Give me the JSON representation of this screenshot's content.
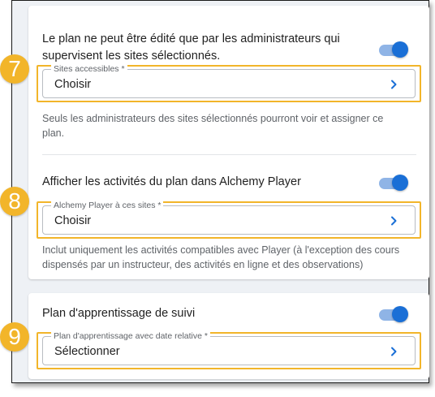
{
  "section_sites": {
    "toggle_label": "Le plan ne peut être édité que par les administrateurs qui supervisent les sites sélectionnés.",
    "toggle_on": true,
    "select_legend": "Sites accessibles *",
    "select_value": "Choisir",
    "helper": "Seuls les administrateurs des sites sélectionnés pourront voir et assigner ce plan.",
    "callout_number": "7"
  },
  "section_player": {
    "toggle_label": "Afficher les activités du plan dans Alchemy Player",
    "toggle_on": true,
    "select_legend": "Alchemy Player à ces sites *",
    "select_value": "Choisir",
    "helper": "Inclut uniquement les activités compatibles avec Player (à l'exception des cours dispensés par un instructeur, des activités en ligne et des observations)",
    "callout_number": "8"
  },
  "section_followup": {
    "toggle_label": "Plan d'apprentissage de suivi",
    "toggle_on": true,
    "select_legend": "Plan d'apprentissage avec date relative *",
    "select_value": "Sélectionner",
    "callout_number": "9"
  },
  "colors": {
    "accent": "#1a6fd6",
    "accent_track": "#8fb4e6",
    "callout": "#f2b52a",
    "background": "#eef1f5"
  },
  "icons": {
    "select_chevron": "chevron-right-icon"
  }
}
